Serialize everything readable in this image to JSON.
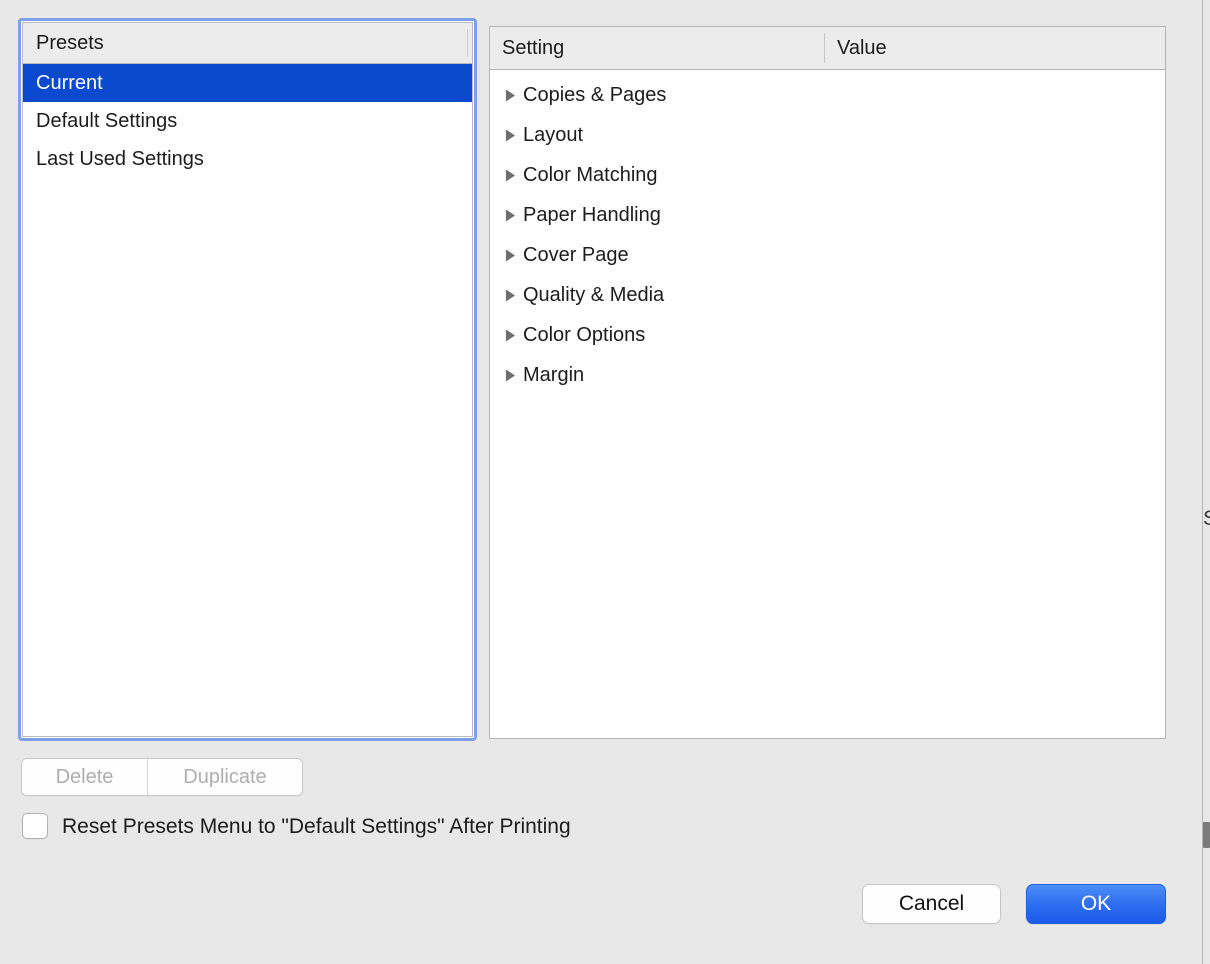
{
  "window": {
    "background_color": "#e8e8e8"
  },
  "presets_panel": {
    "header_title": "Presets",
    "focus_ring_color": "#7f9fe8",
    "selected_color": "#0b49ce",
    "items": [
      {
        "label": "Current",
        "selected": true
      },
      {
        "label": "Default Settings",
        "selected": false
      },
      {
        "label": "Last Used Settings",
        "selected": false
      }
    ]
  },
  "settings_panel": {
    "columns": {
      "setting": "Setting",
      "value": "Value"
    },
    "rows": [
      {
        "label": "Copies & Pages",
        "value": "",
        "expanded": false
      },
      {
        "label": "Layout",
        "value": "",
        "expanded": false
      },
      {
        "label": "Color Matching",
        "value": "",
        "expanded": false
      },
      {
        "label": "Paper Handling",
        "value": "",
        "expanded": false
      },
      {
        "label": "Cover Page",
        "value": "",
        "expanded": false
      },
      {
        "label": "Quality & Media",
        "value": "",
        "expanded": false
      },
      {
        "label": "Color Options",
        "value": "",
        "expanded": false
      },
      {
        "label": "Margin",
        "value": "",
        "expanded": false
      }
    ]
  },
  "segmented_control": {
    "delete_label": "Delete",
    "duplicate_label": "Duplicate",
    "delete_enabled": false,
    "duplicate_enabled": false
  },
  "reset_checkbox": {
    "label": "Reset Presets Menu to \"Default Settings\" After Printing",
    "checked": false
  },
  "actions": {
    "cancel_label": "Cancel",
    "ok_label": "OK",
    "ok_color": "#2f6ff0"
  },
  "background_window": {
    "clipped_letter": "S"
  }
}
